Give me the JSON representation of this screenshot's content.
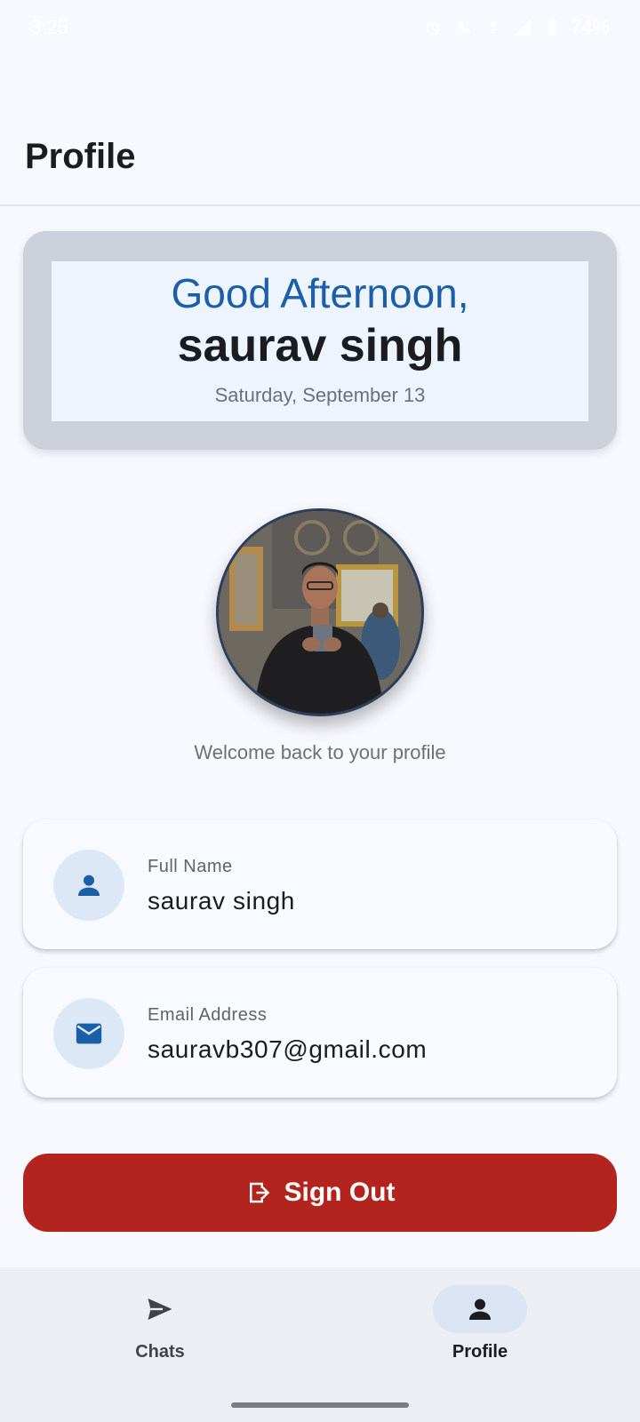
{
  "status_bar": {
    "time": "3:25",
    "battery": "74%"
  },
  "app_bar": {
    "title": "Profile"
  },
  "greeting": {
    "salutation": "Good Afternoon,",
    "name": "saurav singh",
    "date": "Saturday, September 13"
  },
  "avatar": {
    "alt": "profile photo"
  },
  "welcome_text": "Welcome back to your profile",
  "fields": {
    "full_name": {
      "label": "Full Name",
      "value": "saurav singh",
      "icon": "person-icon"
    },
    "email": {
      "label": "Email Address",
      "value": "sauravb307@gmail.com",
      "icon": "mail-icon"
    }
  },
  "sign_out": {
    "label": "Sign Out",
    "icon": "logout-icon"
  },
  "bottom_nav": {
    "items": [
      {
        "label": "Chats",
        "icon": "send-icon",
        "active": false
      },
      {
        "label": "Profile",
        "icon": "person-icon",
        "active": true
      }
    ]
  },
  "colors": {
    "accent": "#1a5fa8",
    "danger": "#b3241e",
    "card_bg": "#cbd0da",
    "greeting_bg": "#eef4fd"
  }
}
